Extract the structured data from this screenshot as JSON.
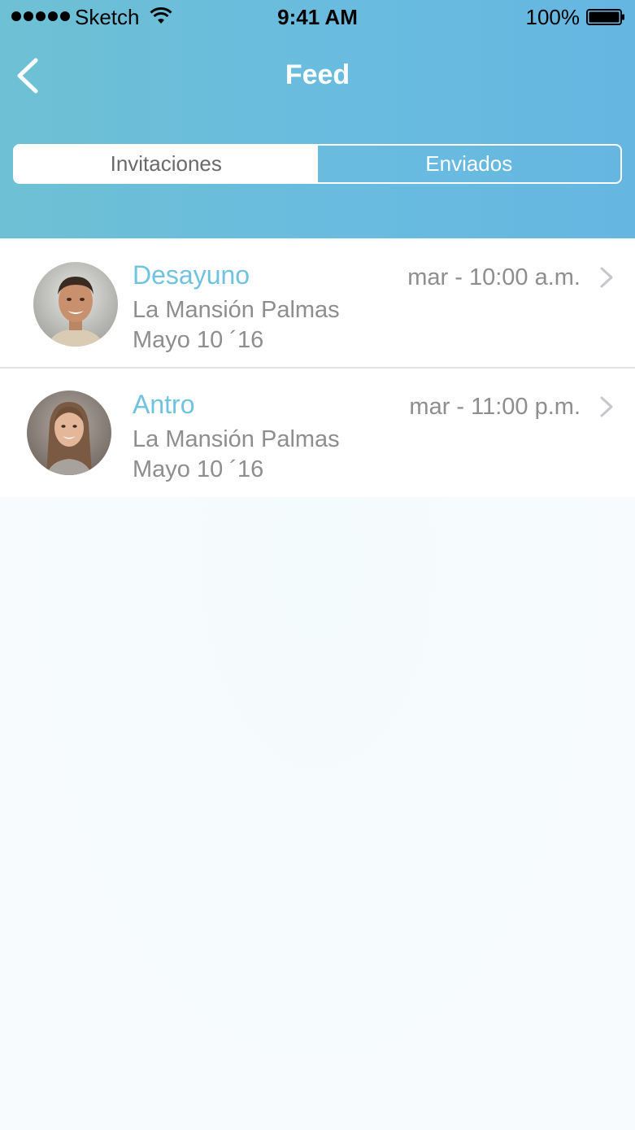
{
  "status_bar": {
    "carrier": "Sketch",
    "time": "9:41 AM",
    "battery": "100%"
  },
  "nav": {
    "title": "Feed",
    "back_icon": "chevron-left-icon"
  },
  "segmented_control": {
    "tabs": [
      {
        "label": "Invitaciones",
        "selected": true
      },
      {
        "label": "Enviados",
        "selected": false
      }
    ]
  },
  "feed": {
    "items": [
      {
        "title": "Desayuno",
        "place": "La Mansión Palmas",
        "date": "Mayo 10 ´16",
        "time": "mar - 10:00 a.m.",
        "avatar": "man-portrait"
      },
      {
        "title": "Antro",
        "place": "La Mansión Palmas",
        "date": "Mayo 10 ´16",
        "time": "mar - 11:00 p.m.",
        "avatar": "girl-portrait"
      }
    ]
  },
  "colors": {
    "header_gradient_start": "#6ec0d4",
    "header_gradient_end": "#66b6e2",
    "accent_title": "#6fc3df",
    "secondary_text": "#8e8e8e"
  }
}
